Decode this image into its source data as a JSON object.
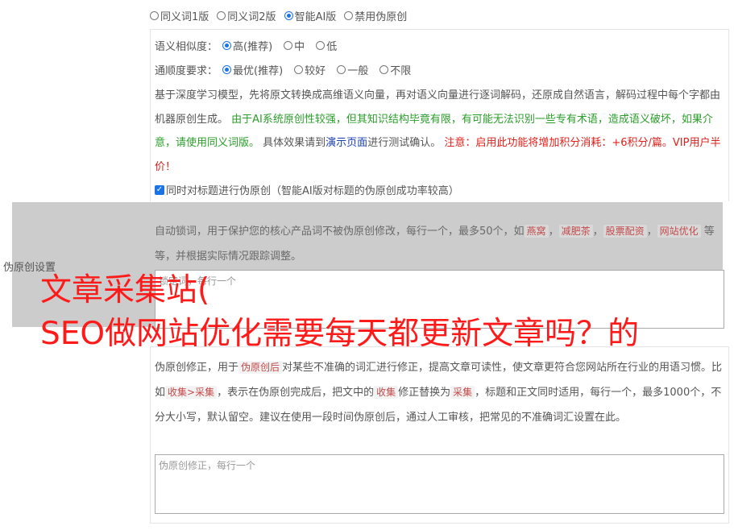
{
  "mode_radios": [
    {
      "label": "同义词1版",
      "checked": false
    },
    {
      "label": "同义词2版",
      "checked": false
    },
    {
      "label": "智能AI版",
      "checked": true
    },
    {
      "label": "禁用伪原创",
      "checked": false
    }
  ],
  "similarity": {
    "label": "语义相似度：",
    "options": [
      {
        "label": "高(推荐)",
        "checked": true
      },
      {
        "label": "中",
        "checked": false
      },
      {
        "label": "低",
        "checked": false
      }
    ]
  },
  "fluency": {
    "label": "通顺度要求：",
    "options": [
      {
        "label": "最优(推荐)",
        "checked": true
      },
      {
        "label": "较好",
        "checked": false
      },
      {
        "label": "一般",
        "checked": false
      },
      {
        "label": "不限",
        "checked": false
      }
    ]
  },
  "ai_desc": {
    "part1": "基于深度学习模型，先将原文转换成高维语义向量，再对语义向量进行逐词解码，还原成自然语言，解码过程中每个字都由机器原创生成。",
    "part2_green": "由于AI系统原创性较强，但其知识结构毕竟有限，有可能无法识别一些专有术语，造成语义破坏，如果介意，请使用同义词版。",
    "part3": "具体效果请到",
    "link": "演示页面",
    "part4": "进行测试确认。",
    "part5_red": "注意：启用此功能将增加积分消耗：+6积分/篇。VIP用户半价！"
  },
  "title_checkbox": {
    "label": "同时对标题进行伪原创（智能AI版对标题的伪原创成功率较高）",
    "checked": true
  },
  "section_label": "伪原创设置",
  "lock_desc": {
    "before": "自动锁词，用于保护您的核心产品词不被伪原创修改，每行一个，最多50个，如",
    "tags": [
      "燕窝",
      "减肥茶",
      "股票配资",
      "网站优化"
    ],
    "after": "等等，并根据实际情况跟踪调整。"
  },
  "lock_textarea_placeholder": "锁定词，每行一个",
  "fix_desc": {
    "p1": "伪原创修正，用于",
    "tag1": "伪原创后",
    "p2": "对某些不准确的词汇进行修正，提高文章可读性，使文章更符合您网站所在行业的用语习惯。比如",
    "tag2": "收集>采集",
    "p3": "，表示在伪原创完成后，把文中的",
    "tag3": "收集",
    "p4": "修正替换为",
    "tag4": "采集",
    "p5": "，标题和正文同时适用，每行一个，最多1000个，不分大小写，默认留空。建议在使用一段时间伪原创后，通过人工审核，把常见的不准确词汇设置在此。"
  },
  "fix_textarea_placeholder": "伪原创修正，每行一个",
  "overlay": {
    "line1": "文章采集站(",
    "line2": "SEO做网站优化需要每天都更新文章吗？的"
  },
  "colors": {
    "accent": "#1a73e8",
    "green": "#2a9d2a",
    "red": "#e0201a",
    "overlay": "#ff1a1a"
  }
}
